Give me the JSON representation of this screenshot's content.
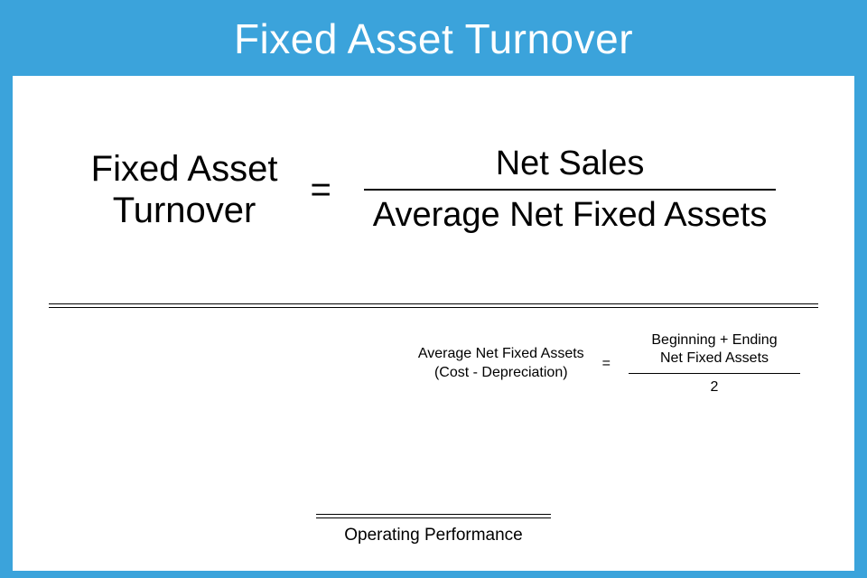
{
  "header": {
    "title": "Fixed Asset Turnover"
  },
  "formula": {
    "lhs_line1": "Fixed Asset",
    "lhs_line2": "Turnover",
    "eq": "=",
    "numerator": "Net Sales",
    "denominator": "Average Net Fixed Assets"
  },
  "sub": {
    "lhs_line1": "Average Net Fixed Assets",
    "lhs_line2": "(Cost - Depreciation)",
    "eq": "=",
    "num_line1": "Beginning + Ending",
    "num_line2": "Net Fixed Assets",
    "den": "2"
  },
  "footer": {
    "label": "Operating Performance"
  }
}
